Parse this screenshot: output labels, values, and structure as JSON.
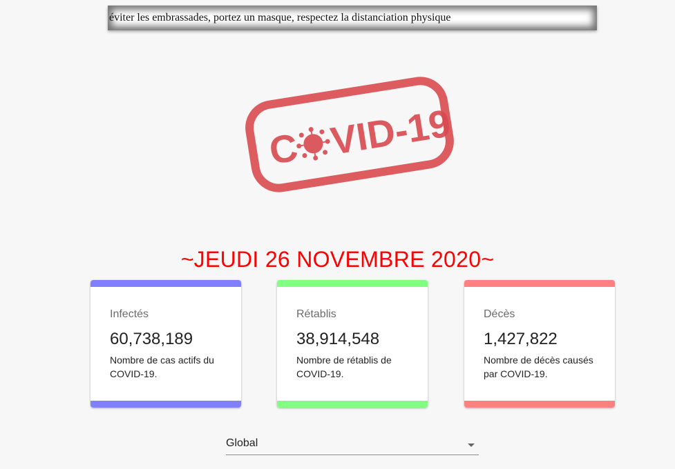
{
  "banner": {
    "message": "éviter les embrassades, portez un masque, respectez la distanciation physique"
  },
  "logo": {
    "text": "COVID-19",
    "color": "#d94a4f"
  },
  "date_heading": "~JEUDI 26 NOVEMBRE 2020~",
  "cards": [
    {
      "title": "Infectés",
      "value": "60,738,189",
      "description": "Nombre de cas actifs du COVID-19.",
      "color": "#8080ff"
    },
    {
      "title": "Rétablis",
      "value": "38,914,548",
      "description": "Nombre de rétablis de COVID-19.",
      "color": "#80ff80"
    },
    {
      "title": "Décès",
      "value": "1,427,822",
      "description": "Nombre de décès causés par COVID-19.",
      "color": "#ff8080"
    }
  ],
  "country_select": {
    "selected": "Global"
  }
}
